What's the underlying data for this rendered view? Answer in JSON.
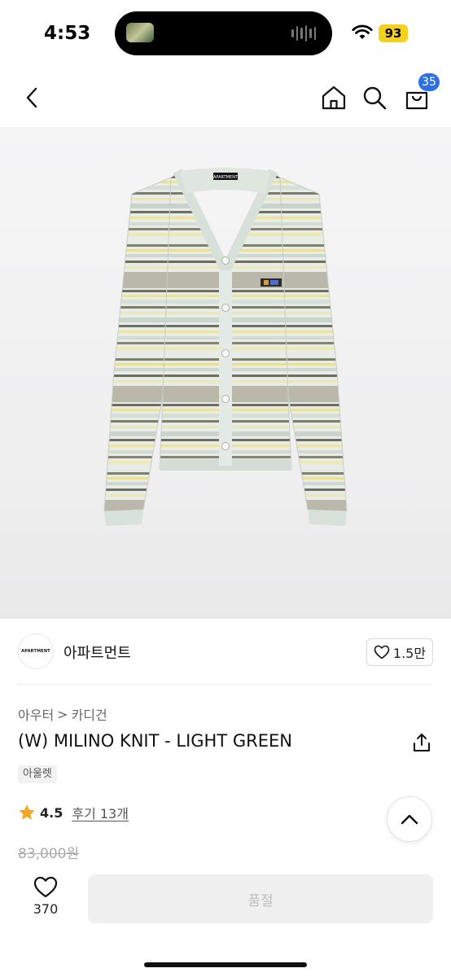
{
  "status_bar": {
    "time": "4:53",
    "battery": "93"
  },
  "nav": {
    "cart_count": "35"
  },
  "product_image": {
    "label_text": "APARTMENT"
  },
  "brand": {
    "logo_text": "APARTMENT",
    "name": "아파트먼트",
    "likes": "1.5만"
  },
  "breadcrumb": {
    "category": "아우터",
    "separator": ">",
    "subcategory": "카디건"
  },
  "product": {
    "title": "(W) MILINO KNIT - LIGHT GREEN",
    "tag": "아울렛",
    "rating": "4.5",
    "reviews": "후기 13개",
    "price": "83,000원"
  },
  "bottom": {
    "wishlist_count": "370",
    "soldout_label": "품절"
  },
  "colors": {
    "accent_blue": "#2f6fe4",
    "star": "#f5a623",
    "battery": "#f4d11e"
  }
}
